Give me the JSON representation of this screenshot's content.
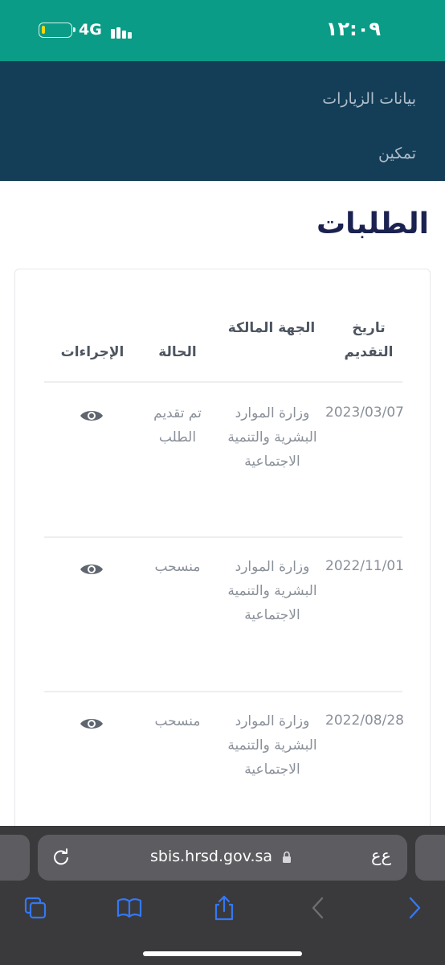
{
  "status_bar": {
    "time": "١٢:٠٩",
    "network": "4G",
    "battery_level": 0.12,
    "signal_bars": 3
  },
  "nav": {
    "items": [
      {
        "label": "بيانات الزيارات"
      },
      {
        "label": "تمكين"
      }
    ]
  },
  "page": {
    "title": "الطلبات"
  },
  "table": {
    "headers": {
      "date": "تاريخ التقديم",
      "owner": "الجهة المالكة",
      "status": "الحالة",
      "actions": "الإجراءات"
    },
    "rows": [
      {
        "date": "2023/03/07",
        "owner": "وزارة الموارد البشرية والتنمية الاجتماعية",
        "status": "تم تقديم الطلب",
        "action_icon": "eye-icon"
      },
      {
        "date": "2022/11/01",
        "owner": "وزارة الموارد البشرية والتنمية الاجتماعية",
        "status": "منسحب",
        "action_icon": "eye-icon"
      },
      {
        "date": "2022/08/28",
        "owner": "وزارة الموارد البشرية والتنمية الاجتماعية",
        "status": "منسحب",
        "action_icon": "eye-icon"
      }
    ]
  },
  "browser": {
    "url": "sbis.hrsd.gov.sa",
    "reader_label": "ﻉﻉ",
    "toolbar_icons": [
      "tabs-icon",
      "bookmarks-icon",
      "share-icon",
      "back-icon",
      "forward-icon"
    ],
    "accent_color": "#3478f6"
  },
  "colors": {
    "status_bar": "#0a9c86",
    "nav_background": "#143e57",
    "title": "#1b2250"
  }
}
